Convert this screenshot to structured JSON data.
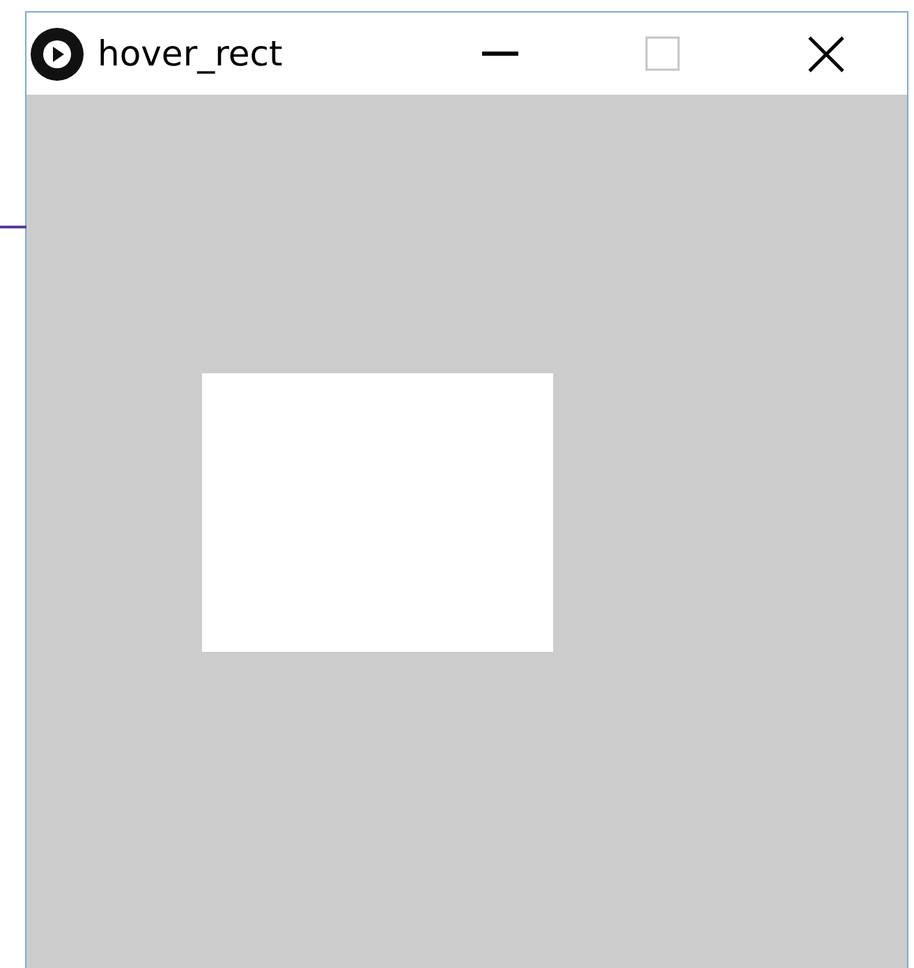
{
  "window": {
    "title": "hover_rect",
    "maximize_disabled": true
  },
  "canvas": {
    "shapes": [
      {
        "kind": "rect"
      }
    ]
  }
}
